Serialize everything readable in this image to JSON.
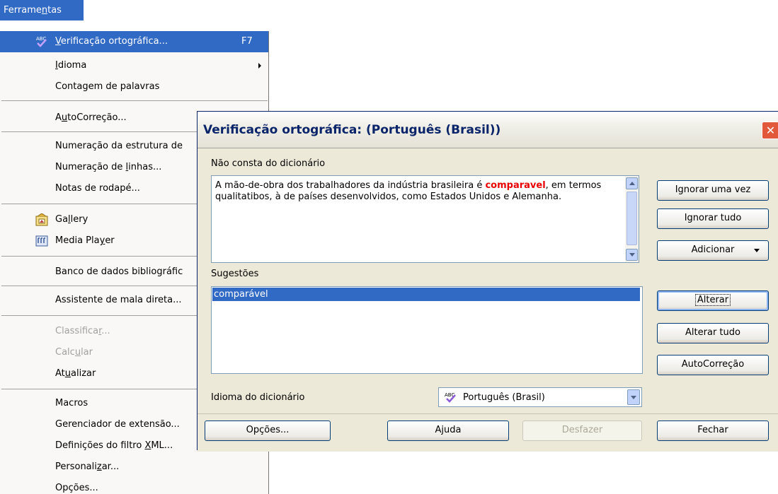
{
  "menu": {
    "title_pre": "Ferrame",
    "title_u": "n",
    "title_post": "tas",
    "items": [
      {
        "pre": "",
        "u": "V",
        "post": "erificação ortográfica...",
        "accel": "F7",
        "icon": "spellcheck-icon"
      },
      {
        "pre": "",
        "u": "I",
        "post": "dioma"
      },
      {
        "pre": "Contagem de palavras",
        "u": "",
        "post": ""
      },
      {
        "pre": "A",
        "u": "u",
        "post": "toCorreção..."
      },
      {
        "pre": "Numeração da estrutura de",
        "u": "",
        "post": ""
      },
      {
        "pre": "Numeração de ",
        "u": "l",
        "post": "inhas..."
      },
      {
        "pre": "Notas de rodapé...",
        "u": "",
        "post": ""
      },
      {
        "pre": "Ga",
        "u": "l",
        "post": "lery",
        "icon": "gallery-icon"
      },
      {
        "pre": "Media Pla",
        "u": "y",
        "post": "er",
        "icon": "media-player-icon"
      },
      {
        "pre": "Banco de dados bibliográfic",
        "u": "",
        "post": ""
      },
      {
        "pre": "Assistente de mala direta...",
        "u": "",
        "post": ""
      },
      {
        "pre": "Classifica",
        "u": "r",
        "post": "..."
      },
      {
        "pre": "Calc",
        "u": "u",
        "post": "lar"
      },
      {
        "pre": "At",
        "u": "u",
        "post": "alizar"
      },
      {
        "pre": "Macros",
        "u": "",
        "post": ""
      },
      {
        "pre": "Gerenciador de extensão...",
        "u": "",
        "post": ""
      },
      {
        "pre": "Definições do filtro ",
        "u": "X",
        "post": "ML..."
      },
      {
        "pre": "Personali",
        "u": "z",
        "post": "ar..."
      },
      {
        "pre": "Opções...",
        "u": "",
        "post": ""
      }
    ]
  },
  "dialog": {
    "title": "Verificação ortográfica:  (Português (Brasil))",
    "close_glyph": "✕",
    "not_in_dict_label": "Não consta do dicionário",
    "text_before": "A mão-de-obra dos trabalhadores da indústria brasileira é ",
    "error_word": "comparavel",
    "text_after": ", em termos qualitatibos, à de países desenvolvidos, como Estados Unidos e Alemanha.",
    "suggestions_label": "Sugestões",
    "suggestions": [
      "comparável"
    ],
    "dict_lang_label": "Idioma do dicionário",
    "dict_lang_value": "Português (Brasil)",
    "abc_glyph": "ABC",
    "buttons": {
      "ignore_once": "Ignorar uma vez",
      "ignore_all": "Ignorar tudo",
      "add": "Adicionar",
      "change": "Alterar",
      "change_all": "Alterar tudo",
      "autocorrect": "AutoCorreção",
      "options": "Opções...",
      "help": "Ajuda",
      "undo": "Desfazer",
      "close": "Fechar"
    }
  }
}
